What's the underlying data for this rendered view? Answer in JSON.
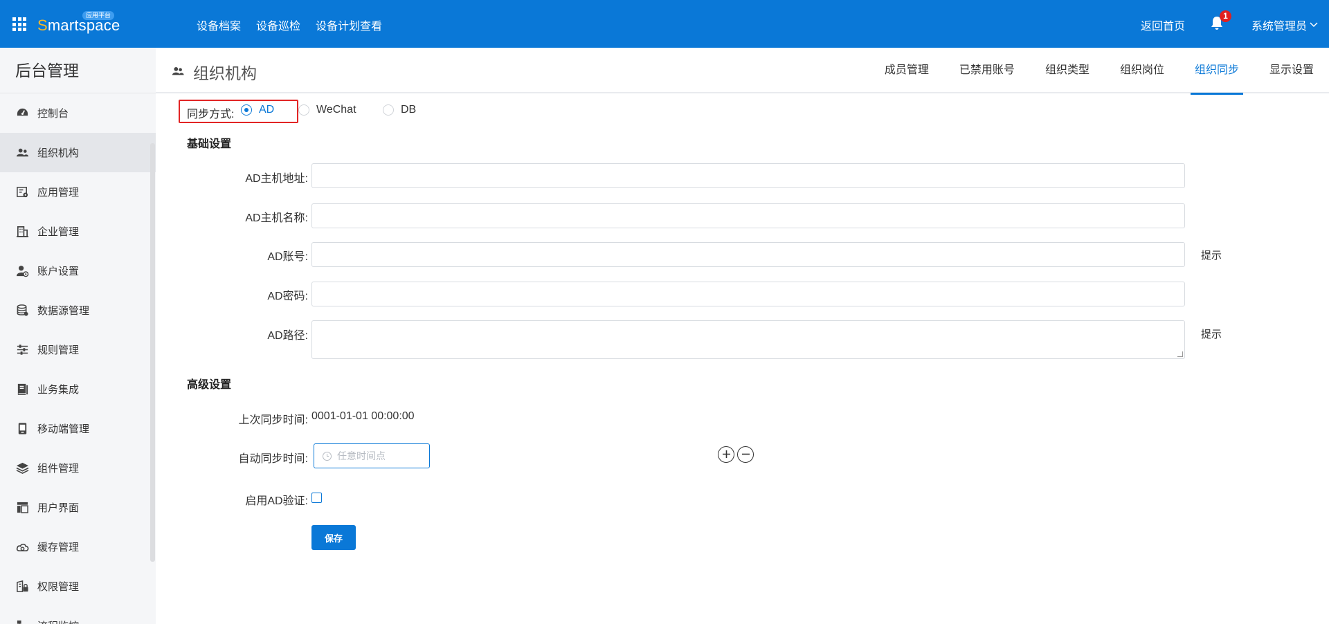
{
  "topbar": {
    "logo_initial": "S",
    "logo_rest": "martspace",
    "logo_badge": "应用平台",
    "nav": [
      "设备档案",
      "设备巡检",
      "设备计划查看"
    ],
    "home_link": "返回首页",
    "notification_count": "1",
    "user": "系统管理员"
  },
  "sidebar": {
    "title": "后台管理",
    "items": [
      {
        "label": "控制台",
        "icon": "dashboard-icon"
      },
      {
        "label": "组织机构",
        "icon": "people-icon",
        "active": true
      },
      {
        "label": "应用管理",
        "icon": "app-settings-icon"
      },
      {
        "label": "企业管理",
        "icon": "building-icon"
      },
      {
        "label": "账户设置",
        "icon": "user-settings-icon"
      },
      {
        "label": "数据源管理",
        "icon": "database-icon"
      },
      {
        "label": "规则管理",
        "icon": "sliders-icon"
      },
      {
        "label": "业务集成",
        "icon": "book-icon"
      },
      {
        "label": "移动端管理",
        "icon": "mobile-icon"
      },
      {
        "label": "组件管理",
        "icon": "layers-icon"
      },
      {
        "label": "用户界面",
        "icon": "layout-icon"
      },
      {
        "label": "缓存管理",
        "icon": "cloud-icon"
      },
      {
        "label": "权限管理",
        "icon": "lock-building-icon"
      },
      {
        "label": "流程监控",
        "icon": "flow-icon"
      }
    ]
  },
  "subheader": {
    "title": "组织机构",
    "tabs": [
      "成员管理",
      "已禁用账号",
      "组织类型",
      "组织岗位",
      "组织同步",
      "显示设置"
    ],
    "active_tab": "组织同步"
  },
  "form": {
    "sync_label": "同步方式:",
    "sync_options": [
      "AD",
      "WeChat",
      "DB"
    ],
    "sync_selected": "AD",
    "basic_title": "基础设置",
    "ad_host_label": "AD主机地址:",
    "ad_hostname_label": "AD主机名称:",
    "ad_account_label": "AD账号:",
    "ad_password_label": "AD密码:",
    "ad_path_label": "AD路径:",
    "hint": "提示",
    "advanced_title": "高级设置",
    "last_sync_label": "上次同步时间:",
    "last_sync_value": "0001-01-01 00:00:00",
    "auto_sync_label": "自动同步时间:",
    "auto_sync_placeholder": "任意时间点",
    "enable_ad_label": "启用AD验证:",
    "save": "保存"
  }
}
